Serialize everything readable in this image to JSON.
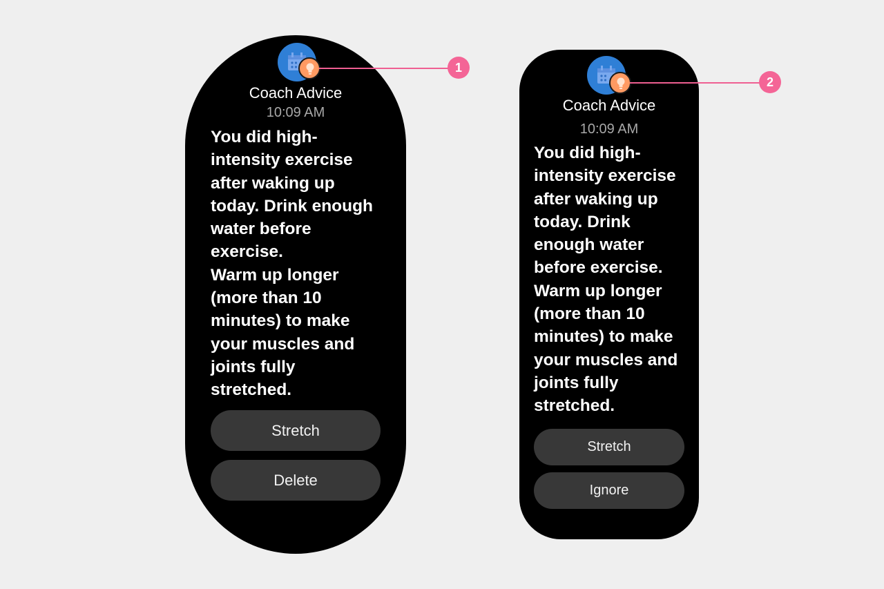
{
  "watches": [
    {
      "title": "Coach Advice",
      "time": "10:09 AM",
      "message": "You did high-\nintensity exercise\nafter waking up\ntoday. Drink enough\nwater before\nexercise.\nWarm up longer\n(more than 10\nminutes) to make\nyour muscles and\njoints fully\nstretched.",
      "buttons": [
        "Stretch",
        "Delete"
      ]
    },
    {
      "title": "Coach Advice",
      "time": "10:09 AM",
      "message": "You did high-\nintensity exercise\nafter waking up\ntoday. Drink\nenough water\nbefore exercise.\nWarm up longer\n(more than 10\nminutes) to make\nyour muscles and\njoints fully\nstretched.",
      "buttons": [
        "Stretch",
        "Ignore"
      ]
    }
  ],
  "callouts": [
    "1",
    "2"
  ],
  "colors": {
    "background": "#efefef",
    "watch_face": "#000000",
    "app_icon": "#2f7fd6",
    "badge": "#ff9a62",
    "button": "#383838",
    "callout": "#f46596",
    "time_text": "#a8a8a8"
  },
  "icons": {
    "app": "calendar-icon",
    "badge": "lightbulb-icon"
  }
}
